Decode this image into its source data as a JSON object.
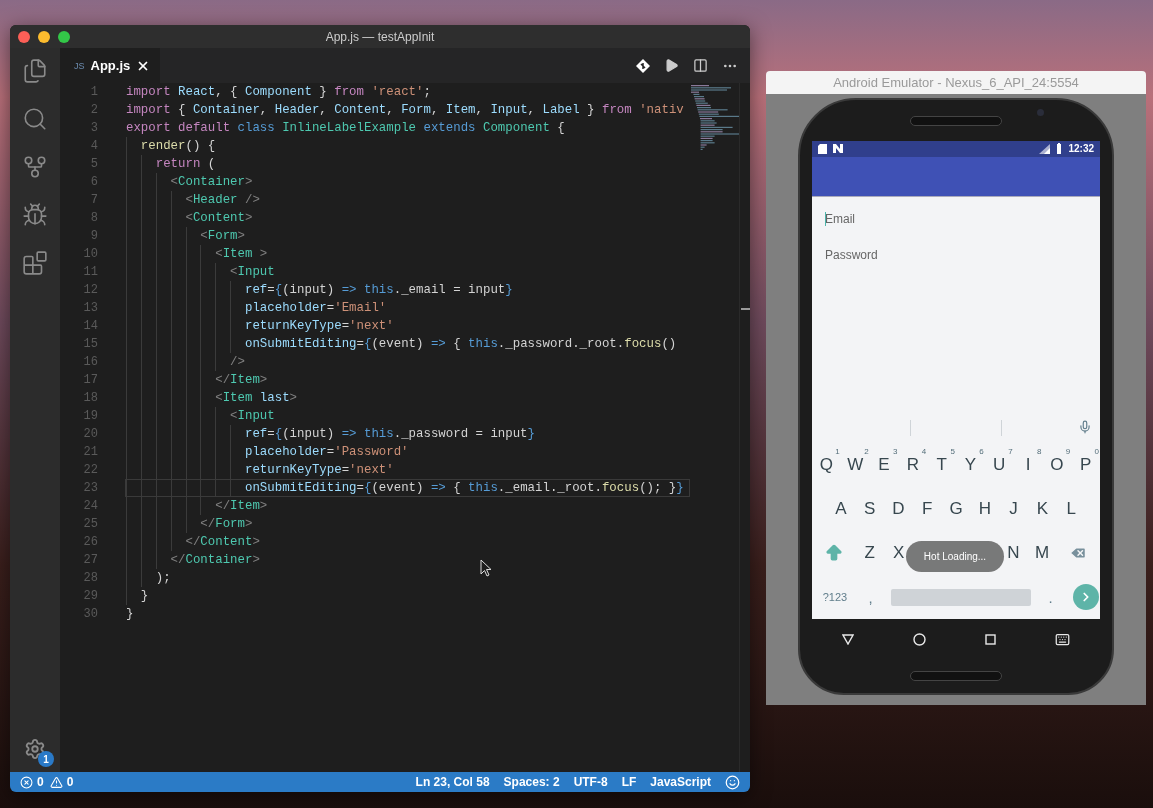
{
  "window": {
    "title": "App.js — testAppInit"
  },
  "activity_bar": {
    "settings_badge": "1"
  },
  "tabs": [
    {
      "icon_label": "JS",
      "label": "App.js",
      "selected": true
    }
  ],
  "editor": {
    "lines": [
      {
        "number": "1",
        "current": false,
        "tokens": [
          {
            "kind": "keyword",
            "text": "import "
          },
          {
            "kind": "variable",
            "text": "React"
          },
          {
            "kind": "plain",
            "text": ", { "
          },
          {
            "kind": "variable",
            "text": "Component"
          },
          {
            "kind": "plain",
            "text": " } "
          },
          {
            "kind": "keyword",
            "text": "from "
          },
          {
            "kind": "string",
            "text": "'react'"
          },
          {
            "kind": "plain",
            "text": ";"
          }
        ]
      },
      {
        "number": "2",
        "current": false,
        "tokens": [
          {
            "kind": "keyword",
            "text": "import"
          },
          {
            "kind": "plain",
            "text": " { "
          },
          {
            "kind": "variable",
            "text": "Container"
          },
          {
            "kind": "plain",
            "text": ", "
          },
          {
            "kind": "variable",
            "text": "Header"
          },
          {
            "kind": "plain",
            "text": ", "
          },
          {
            "kind": "variable",
            "text": "Content"
          },
          {
            "kind": "plain",
            "text": ", "
          },
          {
            "kind": "variable",
            "text": "Form"
          },
          {
            "kind": "plain",
            "text": ", "
          },
          {
            "kind": "variable",
            "text": "Item"
          },
          {
            "kind": "plain",
            "text": ", "
          },
          {
            "kind": "variable",
            "text": "Input"
          },
          {
            "kind": "plain",
            "text": ", "
          },
          {
            "kind": "variable",
            "text": "Label"
          },
          {
            "kind": "plain",
            "text": " } "
          },
          {
            "kind": "keyword",
            "text": "from "
          },
          {
            "kind": "string",
            "text": "'nativ"
          }
        ]
      },
      {
        "number": "3",
        "current": false,
        "tokens": [
          {
            "kind": "keyword",
            "text": "export default "
          },
          {
            "kind": "storage",
            "text": "class "
          },
          {
            "kind": "tag",
            "text": "InlineLabelExample "
          },
          {
            "kind": "storage",
            "text": "extends "
          },
          {
            "kind": "tag",
            "text": "Component"
          },
          {
            "kind": "plain",
            "text": " {"
          }
        ]
      },
      {
        "number": "4",
        "current": false,
        "tokens": [
          {
            "kind": "function",
            "text": "  render"
          },
          {
            "kind": "plain",
            "text": "() {"
          }
        ]
      },
      {
        "number": "5",
        "current": false,
        "tokens": [
          {
            "kind": "keyword",
            "text": "    return"
          },
          {
            "kind": "plain",
            "text": " ("
          }
        ]
      },
      {
        "number": "6",
        "current": false,
        "tokens": [
          {
            "kind": "bracket",
            "text": "      <"
          },
          {
            "kind": "tag",
            "text": "Container"
          },
          {
            "kind": "bracket",
            "text": ">"
          }
        ]
      },
      {
        "number": "7",
        "current": false,
        "tokens": [
          {
            "kind": "bracket",
            "text": "        <"
          },
          {
            "kind": "tag",
            "text": "Header"
          },
          {
            "kind": "bracket",
            "text": " />"
          }
        ]
      },
      {
        "number": "8",
        "current": false,
        "tokens": [
          {
            "kind": "bracket",
            "text": "        <"
          },
          {
            "kind": "tag",
            "text": "Content"
          },
          {
            "kind": "bracket",
            "text": ">"
          }
        ]
      },
      {
        "number": "9",
        "current": false,
        "tokens": [
          {
            "kind": "bracket",
            "text": "          <"
          },
          {
            "kind": "tag",
            "text": "Form"
          },
          {
            "kind": "bracket",
            "text": ">"
          }
        ]
      },
      {
        "number": "10",
        "current": false,
        "tokens": [
          {
            "kind": "bracket",
            "text": "            <"
          },
          {
            "kind": "tag",
            "text": "Item"
          },
          {
            "kind": "bracket",
            "text": " >"
          }
        ]
      },
      {
        "number": "11",
        "current": false,
        "tokens": [
          {
            "kind": "bracket",
            "text": "              <"
          },
          {
            "kind": "tag",
            "text": "Input"
          }
        ]
      },
      {
        "number": "12",
        "current": false,
        "tokens": [
          {
            "kind": "variable",
            "text": "                ref"
          },
          {
            "kind": "plain",
            "text": "="
          },
          {
            "kind": "storage",
            "text": "{"
          },
          {
            "kind": "plain",
            "text": "(input) "
          },
          {
            "kind": "storage",
            "text": "=> this"
          },
          {
            "kind": "plain",
            "text": "._email = input"
          },
          {
            "kind": "storage",
            "text": "}"
          }
        ]
      },
      {
        "number": "13",
        "current": false,
        "tokens": [
          {
            "kind": "variable",
            "text": "                placeholder"
          },
          {
            "kind": "plain",
            "text": "="
          },
          {
            "kind": "string",
            "text": "'Email'"
          }
        ]
      },
      {
        "number": "14",
        "current": false,
        "tokens": [
          {
            "kind": "variable",
            "text": "                returnKeyType"
          },
          {
            "kind": "plain",
            "text": "="
          },
          {
            "kind": "string",
            "text": "'next'"
          }
        ]
      },
      {
        "number": "15",
        "current": false,
        "tokens": [
          {
            "kind": "variable",
            "text": "                onSubmitEditing"
          },
          {
            "kind": "plain",
            "text": "="
          },
          {
            "kind": "storage",
            "text": "{"
          },
          {
            "kind": "plain",
            "text": "(event) "
          },
          {
            "kind": "storage",
            "text": "=>"
          },
          {
            "kind": "plain",
            "text": " { "
          },
          {
            "kind": "storage",
            "text": "this"
          },
          {
            "kind": "plain",
            "text": "._password._root."
          },
          {
            "kind": "function",
            "text": "focus"
          },
          {
            "kind": "plain",
            "text": "()"
          }
        ]
      },
      {
        "number": "16",
        "current": false,
        "tokens": [
          {
            "kind": "bracket",
            "text": "              />"
          }
        ]
      },
      {
        "number": "17",
        "current": false,
        "tokens": [
          {
            "kind": "bracket",
            "text": "            </"
          },
          {
            "kind": "tag",
            "text": "Item"
          },
          {
            "kind": "bracket",
            "text": ">"
          }
        ]
      },
      {
        "number": "18",
        "current": false,
        "tokens": [
          {
            "kind": "bracket",
            "text": "            <"
          },
          {
            "kind": "tag",
            "text": "Item "
          },
          {
            "kind": "variable",
            "text": "last"
          },
          {
            "kind": "bracket",
            "text": ">"
          }
        ]
      },
      {
        "number": "19",
        "current": false,
        "tokens": [
          {
            "kind": "bracket",
            "text": "              <"
          },
          {
            "kind": "tag",
            "text": "Input"
          }
        ]
      },
      {
        "number": "20",
        "current": false,
        "tokens": [
          {
            "kind": "variable",
            "text": "                ref"
          },
          {
            "kind": "plain",
            "text": "="
          },
          {
            "kind": "storage",
            "text": "{"
          },
          {
            "kind": "plain",
            "text": "(input) "
          },
          {
            "kind": "storage",
            "text": "=> this"
          },
          {
            "kind": "plain",
            "text": "._password = input"
          },
          {
            "kind": "storage",
            "text": "}"
          }
        ]
      },
      {
        "number": "21",
        "current": false,
        "tokens": [
          {
            "kind": "variable",
            "text": "                placeholder"
          },
          {
            "kind": "plain",
            "text": "="
          },
          {
            "kind": "string",
            "text": "'Password'"
          }
        ]
      },
      {
        "number": "22",
        "current": false,
        "tokens": [
          {
            "kind": "variable",
            "text": "                returnKeyType"
          },
          {
            "kind": "plain",
            "text": "="
          },
          {
            "kind": "string",
            "text": "'next'"
          }
        ]
      },
      {
        "number": "23",
        "current": true,
        "tokens": [
          {
            "kind": "variable",
            "text": "                onSubmitEditing"
          },
          {
            "kind": "plain",
            "text": "="
          },
          {
            "kind": "storage",
            "text": "{"
          },
          {
            "kind": "plain",
            "text": "(event) "
          },
          {
            "kind": "storage",
            "text": "=>"
          },
          {
            "kind": "plain",
            "text": " { "
          },
          {
            "kind": "storage",
            "text": "this"
          },
          {
            "kind": "plain",
            "text": "._email._root."
          },
          {
            "kind": "function",
            "text": "focus"
          },
          {
            "kind": "plain",
            "text": "(); }"
          },
          {
            "kind": "storage",
            "text": "}"
          }
        ]
      },
      {
        "number": "24",
        "current": false,
        "tokens": [
          {
            "kind": "bracket",
            "text": "            </"
          },
          {
            "kind": "tag",
            "text": "Item"
          },
          {
            "kind": "bracket",
            "text": ">"
          }
        ]
      },
      {
        "number": "25",
        "current": false,
        "tokens": [
          {
            "kind": "bracket",
            "text": "          </"
          },
          {
            "kind": "tag",
            "text": "Form"
          },
          {
            "kind": "bracket",
            "text": ">"
          }
        ]
      },
      {
        "number": "26",
        "current": false,
        "tokens": [
          {
            "kind": "bracket",
            "text": "        </"
          },
          {
            "kind": "tag",
            "text": "Content"
          },
          {
            "kind": "bracket",
            "text": ">"
          }
        ]
      },
      {
        "number": "27",
        "current": false,
        "tokens": [
          {
            "kind": "bracket",
            "text": "      </"
          },
          {
            "kind": "tag",
            "text": "Container"
          },
          {
            "kind": "bracket",
            "text": ">"
          }
        ]
      },
      {
        "number": "28",
        "current": false,
        "tokens": [
          {
            "kind": "plain",
            "text": "    );"
          }
        ]
      },
      {
        "number": "29",
        "current": false,
        "tokens": [
          {
            "kind": "plain",
            "text": "  }"
          }
        ]
      },
      {
        "number": "30",
        "current": false,
        "tokens": [
          {
            "kind": "plain",
            "text": "}"
          }
        ]
      }
    ]
  },
  "status_bar": {
    "errors": "0",
    "warnings": "0",
    "items": [
      "Ln 23, Col 58",
      "Spaces: 2",
      "UTF-8",
      "LF",
      "JavaScript"
    ]
  },
  "emulator": {
    "title": "Android Emulator - Nexus_6_API_24:5554",
    "time": "12:32",
    "fields": [
      {
        "placeholder": "Email",
        "focused": true
      },
      {
        "placeholder": "Password",
        "focused": false
      }
    ],
    "keyboard": {
      "rows": [
        [
          {
            "label": "Q",
            "hint": "1"
          },
          {
            "label": "W",
            "hint": "2"
          },
          {
            "label": "E",
            "hint": "3"
          },
          {
            "label": "R",
            "hint": "4"
          },
          {
            "label": "T",
            "hint": "5"
          },
          {
            "label": "Y",
            "hint": "6"
          },
          {
            "label": "U",
            "hint": "7"
          },
          {
            "label": "I",
            "hint": "8"
          },
          {
            "label": "O",
            "hint": "9"
          },
          {
            "label": "P",
            "hint": "0"
          }
        ],
        [
          {
            "label": "A"
          },
          {
            "label": "S"
          },
          {
            "label": "D"
          },
          {
            "label": "F"
          },
          {
            "label": "G"
          },
          {
            "label": "H"
          },
          {
            "label": "J"
          },
          {
            "label": "K"
          },
          {
            "label": "L"
          }
        ]
      ],
      "row3_left": [
        {
          "label": "Z"
        },
        {
          "label": "X"
        }
      ],
      "row3_right": [
        {
          "label": "N"
        },
        {
          "label": "M"
        }
      ],
      "symbols": "?123",
      "comma": ",",
      "period": "."
    },
    "toast": "Hot Loading..."
  }
}
